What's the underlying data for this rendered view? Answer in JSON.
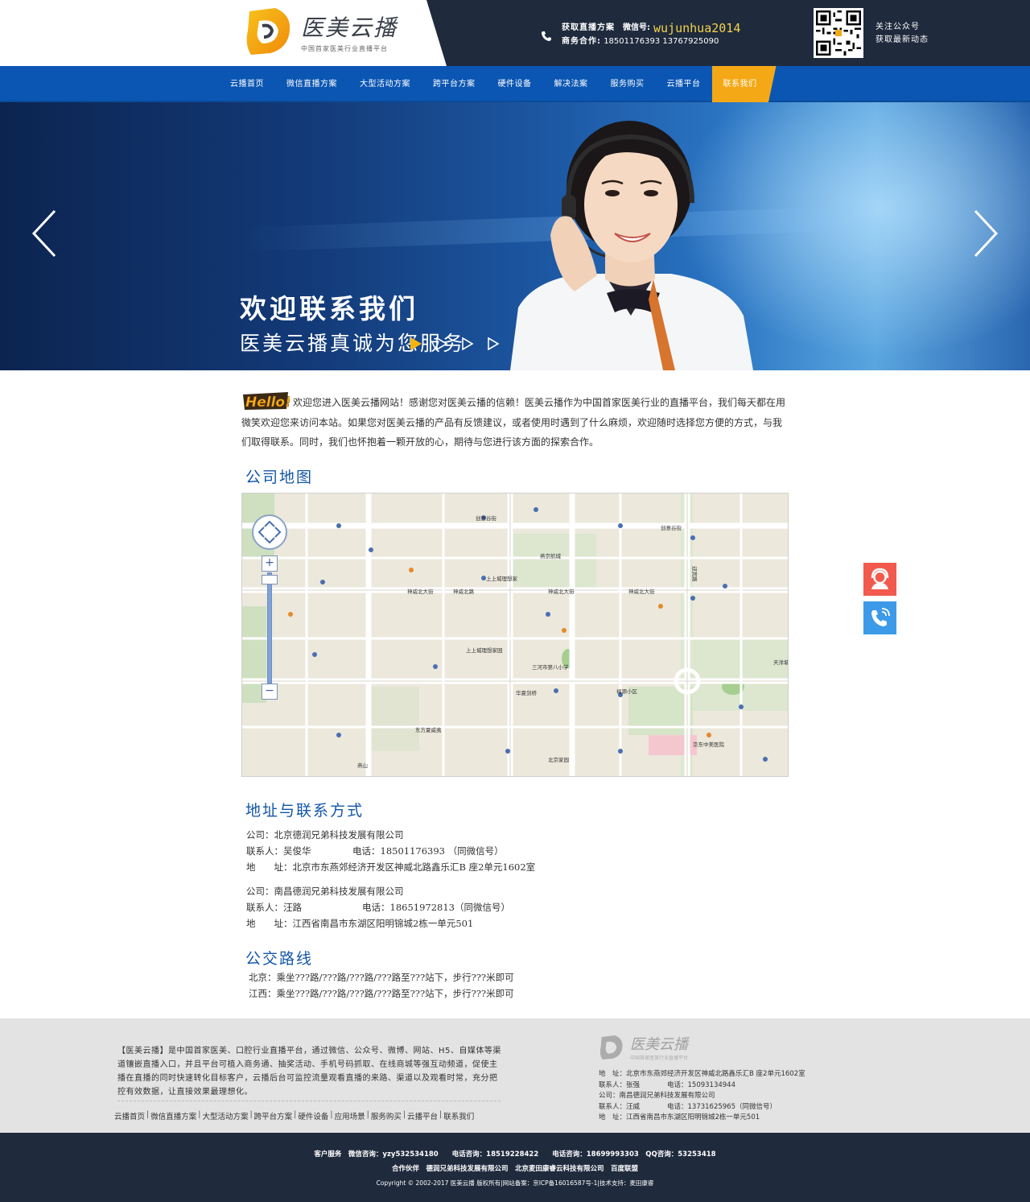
{
  "header": {
    "logo_name": "医美云播",
    "logo_sub": "中国首家医美行业直播平台",
    "get_plan_label": "获取直播方案",
    "wechat_label": "微信号:",
    "wechat_id": "wujunhua2014",
    "biz_label": "商务合作:",
    "biz_phones": "18501176393  13767925090",
    "follow_line1": "关注公众号",
    "follow_line2": "获取最新动态"
  },
  "nav": {
    "items": [
      {
        "label": "云播首页"
      },
      {
        "label": "微信直播方案"
      },
      {
        "label": "大型活动方案"
      },
      {
        "label": "跨平台方案"
      },
      {
        "label": "硬件设备"
      },
      {
        "label": "解决法案"
      },
      {
        "label": "服务购买"
      },
      {
        "label": "云播平台"
      },
      {
        "label": "联系我们"
      }
    ],
    "active_index": 8,
    "active_color": "#f5a815",
    "bar_color": "#0b56b3"
  },
  "banner": {
    "title": "欢迎联系我们",
    "subtitle": "医美云播真诚为您服务",
    "slide_count": 4,
    "active_slide": 1,
    "active_dot_color": "#f5b50f"
  },
  "intro": {
    "hello_icon": "hello-badge-icon",
    "text": "欢迎您进入医美云播网站！感谢您对医美云播的信赖！医美云播作为中国首家医美行业的直播平台，我们每天都在用微笑欢迎您来访问本站。如果您对医美云播的产品有反馈建议，或者使用时遇到了什么麻烦，欢迎随时选择您方便的方式，与我们取得联系。同时，我们也怀抱着一颗开放的心，期待与您进行该方面的探索合作。"
  },
  "sections": {
    "map_title": "公司地图",
    "address_title": "地址与联系方式",
    "bus_title": "公交路线"
  },
  "map": {
    "labels": {
      "yanjing": "燕京航城",
      "shenwei1": "神威北大街",
      "shenwei2": "神威北路",
      "shenwei3": "神威北大街",
      "yingbin": "迎宾路",
      "tianyang": "天洋城",
      "chuangye": "创意谷街",
      "shangshang": "上上城理想家",
      "shangshang2": "上上城理想家园",
      "shanhe": "三河市第八小学",
      "dong": "东方夏威夷",
      "yanshan": "燕山",
      "beijingjia": "北京家园",
      "fuyuan": "福源小区",
      "jingdong": "京东中美医院",
      "huade": "华夏剑桥"
    }
  },
  "contacts": {
    "company1": "公司：北京德润兄弟科技发展有限公司",
    "person1_lbl": "联系人：吴俊华",
    "phone1": "电话：18501176393 （同微信号）",
    "address1": "地　　址：北京市东燕郊经济开发区神威北路鑫乐汇B 座2单元1602室",
    "company2": "公司：南昌德润兄弟科技发展有限公司",
    "person2_lbl": "联系人：汪路",
    "phone2": "电话：18651972813（同微信号）",
    "address2": "地　　址：江西省南昌市东湖区阳明锦城2栋一单元501"
  },
  "bus": {
    "line1": "北京：乘坐???路/???路/???路/???路至???站下，步行???米即可",
    "line2": "江西：乘坐???路/???路/???路/???路至???站下，步行???米即可"
  },
  "float": {
    "service_icon": "customer-service-icon",
    "phone_icon": "phone-call-icon",
    "service_color": "#f25a4e",
    "phone_color": "#3d9ae8"
  },
  "footer": {
    "desc": "【医美云播】是中国首家医美、口腔行业直播平台，通过微信、公众号、微博、网站、H5、自媒体等渠道镶嵌直播入口，并且平台可植入商务通、抽奖活动、手机号码抓取、在线商城等强互动频道，促使主播在直播的同时快速转化目标客户，云播后台可监控流量观看直播的来路、渠道以及观看时常，充分把控有效数据，让直接效果最理想化。",
    "links": [
      "云播首页",
      "微信直播方案",
      "大型活动方案",
      "跨平台方案",
      "硬件设备",
      "应用场景",
      "服务购买",
      "云播平台",
      "联系我们"
    ],
    "logo_name": "医美云播",
    "logo_sub": "中国首家医美行业直播平台",
    "c1": "地　址：北京市东燕郊经济开发区神威北路鑫乐汇B 座2单元1602室",
    "c2": "联系人：张强　　　　电话：15093134944",
    "c3": "公司：南昌德润兄弟科技发展有限公司",
    "c4": "联系人：汪威　　　　电话：13731625965（同微信号）",
    "c5": "地　址：江西省南昌市东湖区阳明锦城2栋一单元501"
  },
  "bottom": {
    "line1": "客户服务　微信咨询：yzy532534180　　电话咨询：18519228422　　电话咨询：18699993303　QQ咨询：53253418",
    "line2": "合作伙伴　德润兄弟科技发展有限公司　北京麦田康睿云科技有限公司　百度联盟",
    "line3": "Copyright © 2002-2017 医美云播 版权所有|网站备案：京ICP备16016587号-1|技术支持：麦田康睿"
  }
}
